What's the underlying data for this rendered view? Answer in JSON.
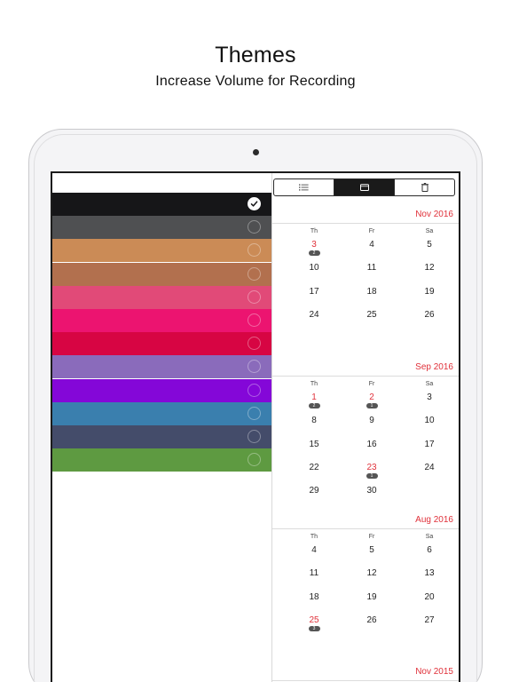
{
  "header": {
    "title": "Themes",
    "subtitle": "Increase Volume for Recording"
  },
  "theme_list": {
    "swatches": [
      {
        "color": "#161618",
        "selected": true
      },
      {
        "color": "#4f5052",
        "selected": false
      },
      {
        "color": "#cb8b56",
        "selected": false
      },
      {
        "color": "#b2704e",
        "selected": false
      },
      {
        "color": "#e14a78",
        "selected": false
      },
      {
        "color": "#ec1470",
        "selected": false
      },
      {
        "color": "#d70543",
        "selected": false
      },
      {
        "color": "#8a6bbb",
        "selected": false
      },
      {
        "color": "#8407d8",
        "selected": false
      },
      {
        "color": "#3a7fae",
        "selected": false
      },
      {
        "color": "#444c6a",
        "selected": false
      },
      {
        "color": "#5e9a41",
        "selected": false
      }
    ]
  },
  "toolbar": {
    "segments": [
      {
        "icon": "list-icon",
        "selected": false
      },
      {
        "icon": "calendar-icon",
        "selected": true
      },
      {
        "icon": "trash-icon",
        "selected": false
      }
    ]
  },
  "calendar": {
    "day_headers": [
      "Th",
      "Fr",
      "Sa"
    ],
    "months": [
      {
        "title": "Nov 2016",
        "rows": [
          [
            {
              "d": "3",
              "red": true,
              "count": "2"
            },
            {
              "d": "4"
            },
            {
              "d": "5"
            }
          ],
          [
            {
              "d": "10"
            },
            {
              "d": "11"
            },
            {
              "d": "12"
            }
          ],
          [
            {
              "d": "17"
            },
            {
              "d": "18"
            },
            {
              "d": "19"
            }
          ],
          [
            {
              "d": "24"
            },
            {
              "d": "25"
            },
            {
              "d": "26"
            }
          ]
        ]
      },
      {
        "title": "Sep 2016",
        "rows": [
          [
            {
              "d": "1",
              "red": true,
              "count": "2"
            },
            {
              "d": "2",
              "red": true,
              "count": "1"
            },
            {
              "d": "3"
            }
          ],
          [
            {
              "d": "8"
            },
            {
              "d": "9"
            },
            {
              "d": "10"
            }
          ],
          [
            {
              "d": "15"
            },
            {
              "d": "16"
            },
            {
              "d": "17"
            }
          ],
          [
            {
              "d": "22"
            },
            {
              "d": "23",
              "red": true,
              "count": "1"
            },
            {
              "d": "24"
            }
          ],
          [
            {
              "d": "29"
            },
            {
              "d": "30"
            },
            {
              "d": ""
            }
          ]
        ]
      },
      {
        "title": "Aug 2016",
        "rows": [
          [
            {
              "d": "4"
            },
            {
              "d": "5"
            },
            {
              "d": "6"
            }
          ],
          [
            {
              "d": "11"
            },
            {
              "d": "12"
            },
            {
              "d": "13"
            }
          ],
          [
            {
              "d": "18"
            },
            {
              "d": "19"
            },
            {
              "d": "20"
            }
          ],
          [
            {
              "d": "25",
              "red": true,
              "count": "3"
            },
            {
              "d": "26"
            },
            {
              "d": "27"
            }
          ]
        ]
      },
      {
        "title": "Nov 2015",
        "rows": []
      }
    ]
  }
}
